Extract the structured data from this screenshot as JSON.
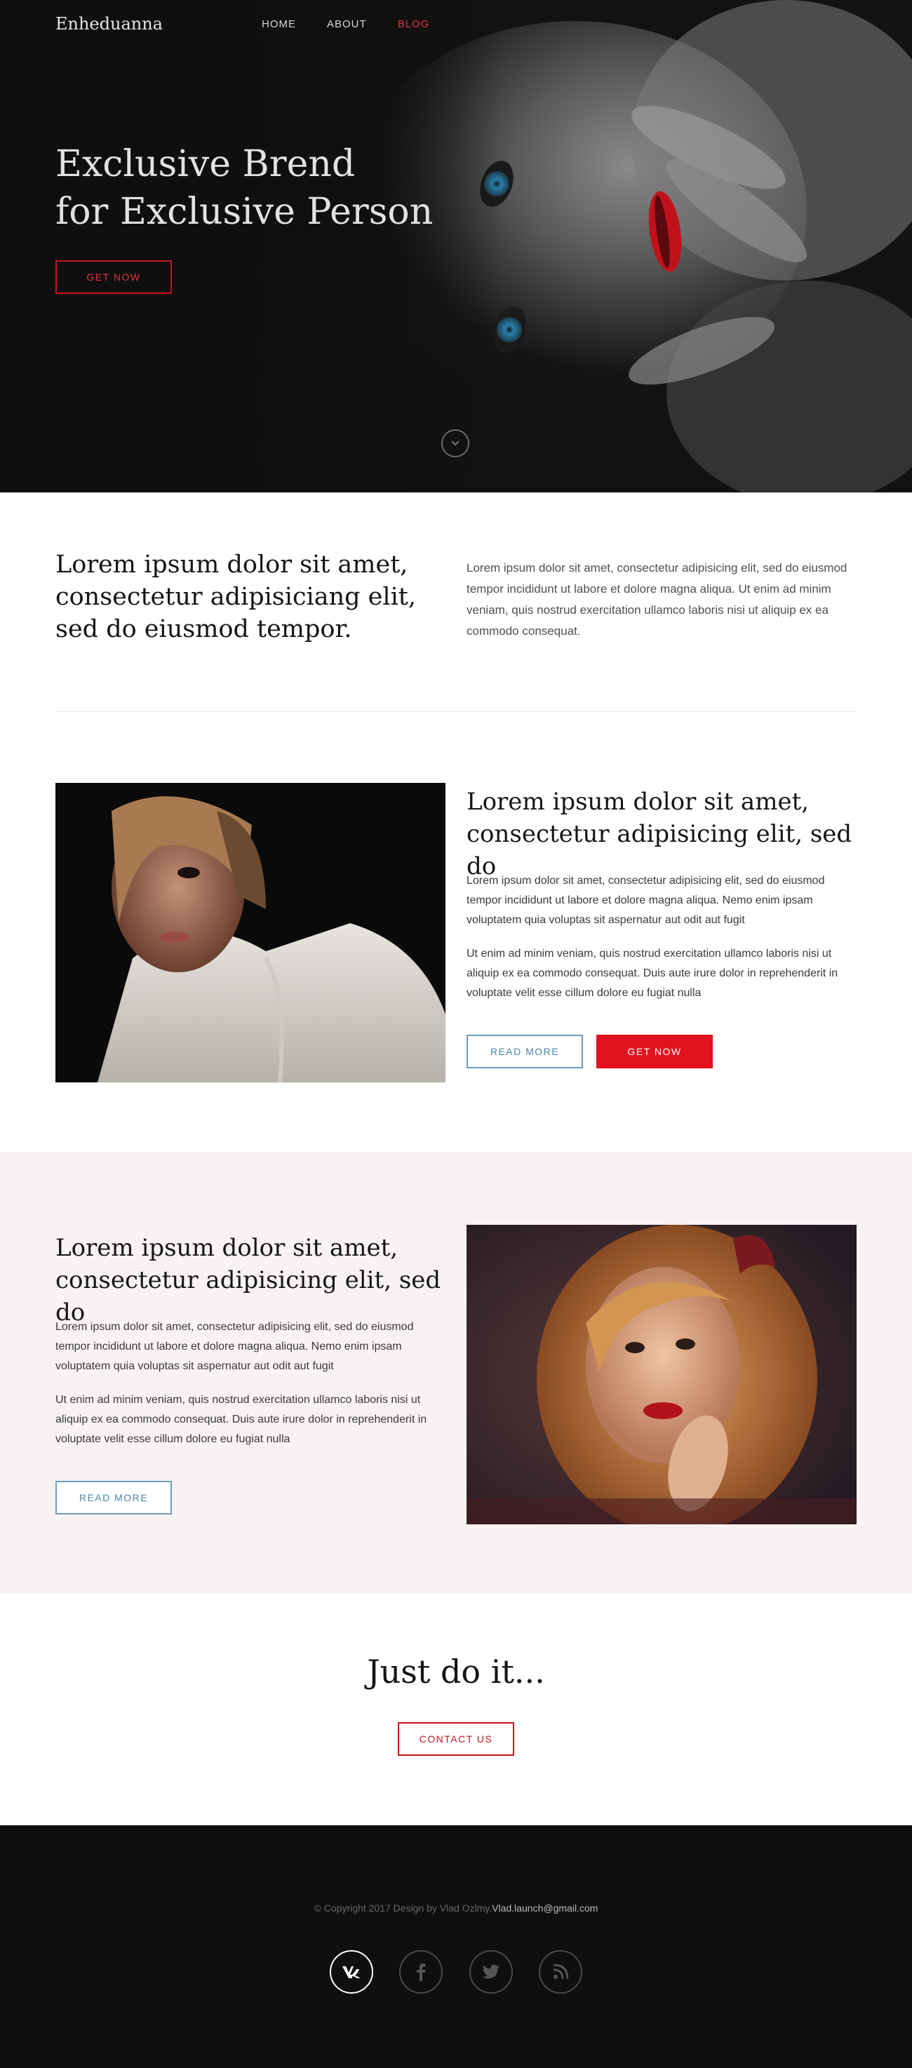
{
  "brand": "Enheduanna",
  "nav": {
    "home": "HOME",
    "about": "ABOUT",
    "blog": "BLOG"
  },
  "hero": {
    "title_line1": "Exclusive Brend",
    "title_line2": "for Exclusive Person",
    "button": "GET NOW"
  },
  "intro": {
    "heading": "Lorem ipsum dolor sit amet, consectetur adipisiciang elit, sed do eiusmod tempor.",
    "text": "Lorem ipsum dolor sit amet, consectetur adipisicing elit, sed do eiusmod tempor incididunt ut labore et dolore magna aliqua. Ut enim ad minim veniam, quis nostrud exercitation ullamco laboris nisi ut aliquip ex ea commodo consequat."
  },
  "feature1": {
    "heading": "Lorem ipsum dolor sit amet, consectetur adipisicing elit, sed do",
    "p1": "Lorem ipsum dolor sit amet, consectetur adipisicing elit, sed do eiusmod tempor incididunt ut labore et dolore magna aliqua.  Nemo enim ipsam voluptatem quia voluptas sit aspernatur aut odit aut fugit",
    "p2": "Ut enim ad minim veniam, quis nostrud exercitation ullamco laboris nisi ut aliquip ex ea commodo consequat. Duis aute irure dolor in reprehenderit in voluptate velit esse cillum dolore eu fugiat nulla",
    "read_more": "READ MORE",
    "get_now": "GET NOW"
  },
  "feature2": {
    "heading": "Lorem ipsum dolor sit amet, consectetur adipisicing elit, sed do",
    "p1": "Lorem ipsum dolor sit amet, consectetur adipisicing elit, sed do eiusmod tempor incididunt ut labore et dolore magna aliqua.  Nemo enim ipsam voluptatem quia voluptas sit aspernatur aut odit aut fugit",
    "p2": "Ut enim ad minim veniam, quis nostrud exercitation ullamco laboris nisi ut aliquip ex ea commodo consequat. Duis aute irure dolor in reprehenderit in voluptate velit esse cillum dolore eu fugiat nulla",
    "read_more": "READ MORE"
  },
  "cta": {
    "title": "Just do it...",
    "button": "CONTACT US"
  },
  "footer": {
    "copyright": "© Copyright 2017 Design by Vlad Ozlmy.",
    "email": "Vlad.launch@gmail.com",
    "socials": [
      "vk-icon",
      "facebook-icon",
      "twitter-icon",
      "rss-icon"
    ]
  },
  "colors": {
    "accent_red": "#e3121f",
    "accent_blue": "#4f86ab",
    "footer_bg": "#0f0f0f",
    "band_bg": "#f8f3f3"
  }
}
